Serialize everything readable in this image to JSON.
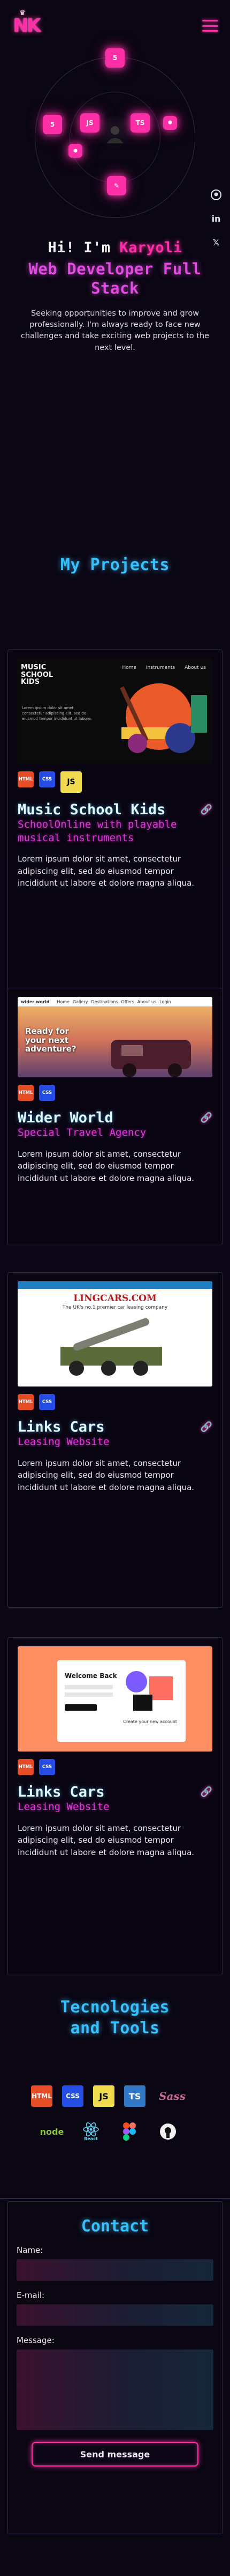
{
  "header": {
    "logo_text": "NK",
    "logo_sub": "NK"
  },
  "hero": {
    "greeting_prefix": "Hi! I'm ",
    "name": "Karyoli",
    "role": "Web Developer Full Stack",
    "bio": "Seeking opportunities to improve and grow professionally. I'm always ready to face new challenges and take exciting web projects to the next level."
  },
  "orbit_icons": [
    "5",
    "5",
    "JS",
    "TS",
    "JS"
  ],
  "side_links": [
    "github-icon",
    "linkedin-icon",
    "x-icon"
  ],
  "projects": {
    "title": "My Projects",
    "items": [
      {
        "title": "Music School Kids",
        "subtitle": "SchoolOnline with playable musical instruments",
        "desc": "Lorem ipsum dolor sit amet, consectetur adipiscing elit, sed do eiusmod tempor incididunt ut labore et dolore magna aliqua.",
        "tech": [
          "HTML",
          "CSS",
          "JS"
        ],
        "thumb": {
          "brand": "MUSIC SCHOOL KIDS",
          "nav": [
            "Home",
            "Instruments",
            "About us"
          ],
          "text": "Lorem ipsum dolor sit amet, consectetur adipiscing elit, sed do eiusmod tempor incididunt ut labore."
        }
      },
      {
        "title": "Wider World",
        "subtitle": "Special Travel Agency",
        "desc": "Lorem ipsum dolor sit amet, consectetur adipiscing elit, sed do eiusmod tempor incididunt ut labore et dolore magna aliqua.",
        "tech": [
          "HTML",
          "CSS"
        ],
        "thumb": {
          "brand": "wider world",
          "nav": [
            "Home",
            "Gallery",
            "Destinations",
            "Offers",
            "About us",
            "Login"
          ],
          "headline": "Ready for your next adventure?"
        }
      },
      {
        "title": "Links Cars",
        "subtitle": "Leasing Website",
        "desc": "Lorem ipsum dolor sit amet, consectetur adipiscing elit, sed do eiusmod tempor incididunt ut labore et dolore magna aliqua.",
        "tech": [
          "HTML",
          "CSS"
        ],
        "thumb": {
          "brand": "LINGCARS.COM",
          "tagline": "The UK's no.1 premier car leasing company"
        }
      },
      {
        "title": "Links Cars",
        "subtitle": "Leasing Website",
        "desc": "Lorem ipsum dolor sit amet, consectetur adipiscing elit, sed do eiusmod tempor incididunt ut labore et dolore magna aliqua.",
        "tech": [
          "HTML",
          "CSS"
        ],
        "thumb": {
          "brand": "Welcome Back",
          "caption": "Create your new account"
        }
      }
    ]
  },
  "tools": {
    "title": "Tecnologies and Tools",
    "row1": [
      "HTML",
      "CSS",
      "JS",
      "TS",
      "Sass"
    ],
    "row2": [
      "node",
      "React",
      "Figma",
      "GitHub"
    ]
  },
  "contact": {
    "title": "Contact",
    "name_label": "Name:",
    "email_label": "E-mail:",
    "message_label": "Message:",
    "send_label": "Send message"
  },
  "colors": {
    "background": "#0a0612",
    "accent_pink": "#ff2fa8",
    "accent_blue": "#39c0ff",
    "accent_magenta": "#e039d8"
  }
}
